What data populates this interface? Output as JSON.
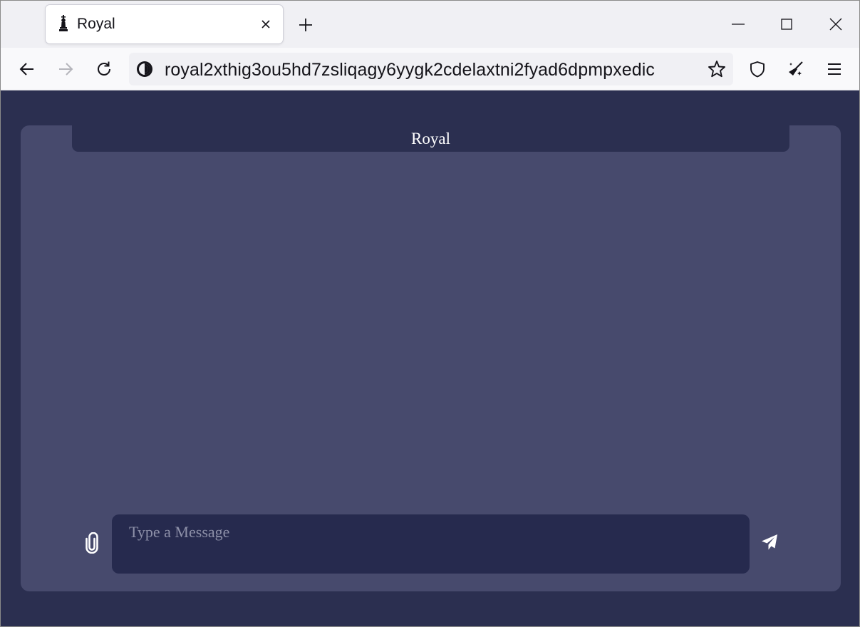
{
  "browser": {
    "tab": {
      "title": "Royal",
      "favicon": "chess-king-icon",
      "close_icon": "close-icon"
    },
    "new_tab_icon": "plus-icon",
    "window_controls": [
      "minimize-icon",
      "maximize-icon",
      "close-icon"
    ],
    "nav": {
      "back_icon": "back-arrow-icon",
      "forward_icon": "forward-arrow-icon",
      "reload_icon": "reload-icon"
    },
    "url_bar": {
      "site_icon": "onion-site-icon",
      "url": "royal2xthig3ou5hd7zsliqagy6yygk2cdelaxtni2fyad6dpmpxedic",
      "bookmark_icon": "star-icon"
    },
    "toolbar_icons": [
      "shield-icon",
      "broom-icon",
      "menu-icon"
    ]
  },
  "chat": {
    "title": "Royal",
    "composer": {
      "placeholder": "Type a Message",
      "value": "",
      "attach_icon": "paperclip-icon",
      "send_icon": "send-icon"
    }
  },
  "colors": {
    "page_bg": "#2b2f50",
    "panel_bg": "#474a6d",
    "input_bg": "#262a4e",
    "chrome_bg": "#f0f0f4"
  }
}
